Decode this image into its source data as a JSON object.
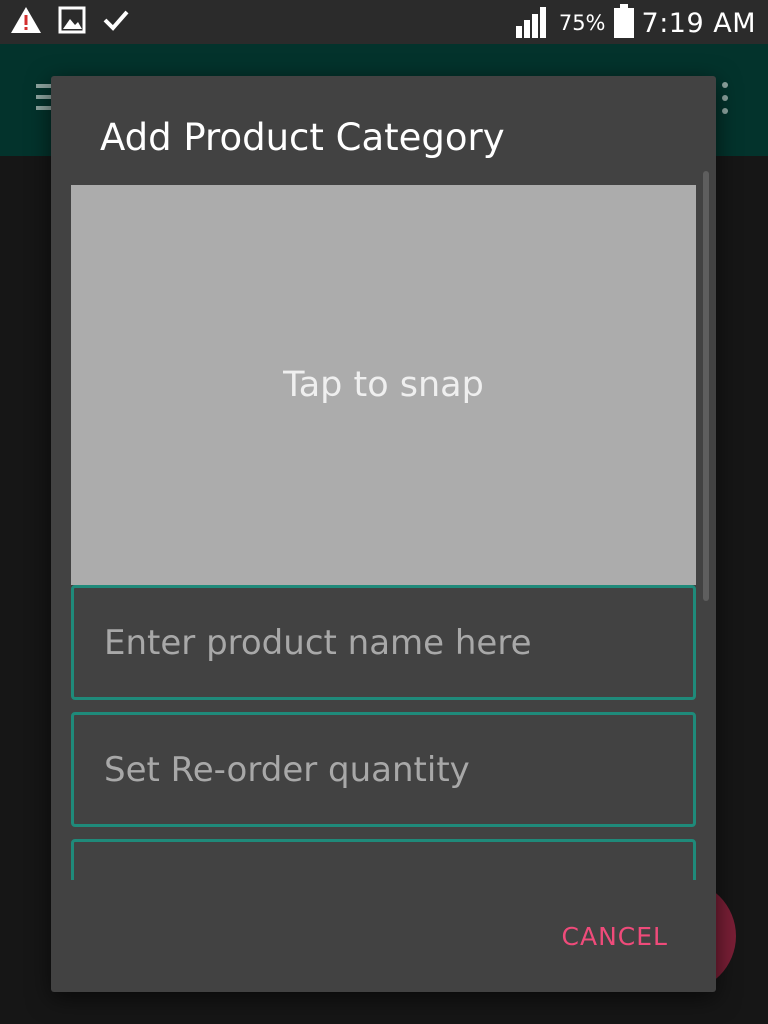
{
  "status_bar": {
    "icons": [
      "warning-icon",
      "image-icon",
      "check-icon",
      "signal-icon",
      "battery-icon"
    ],
    "battery_percent": "75%",
    "time": "7:19 AM"
  },
  "app_bar": {
    "icons": [
      "menu-icon",
      "overflow-menu-icon"
    ],
    "accent_color": "#03332c"
  },
  "dialog": {
    "title": "Add Product Category",
    "photo_placeholder": "Tap to snap",
    "fields": [
      {
        "placeholder": "Enter product name here",
        "value": ""
      },
      {
        "placeholder": "Set Re-order quantity",
        "value": ""
      },
      {
        "placeholder": "",
        "value": ""
      }
    ],
    "cancel_label": "CANCEL",
    "field_border_color": "#1f8a7a",
    "button_color": "#ef4b7a"
  }
}
